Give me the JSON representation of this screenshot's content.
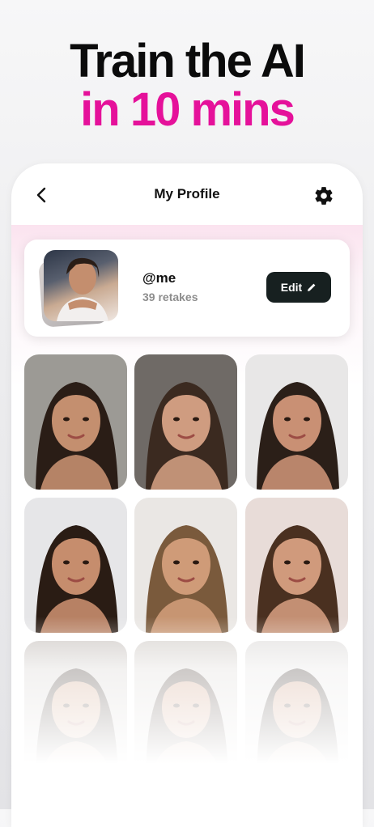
{
  "promo": {
    "line1": "Train the AI",
    "line2": "in 10 mins",
    "line2_color": "#e5119a"
  },
  "header": {
    "title": "My Profile",
    "back_icon": "chevron-left-icon",
    "settings_icon": "gear-icon"
  },
  "profile": {
    "handle": "@me",
    "retakes": "39 retakes",
    "edit_label": "Edit",
    "edit_icon": "pencil-icon",
    "button_color": "#172020"
  },
  "photos": [
    {
      "name": "photo-1",
      "bg": "#9c9a95",
      "skin": "#c48f6f",
      "hair": "#2a1d16"
    },
    {
      "name": "photo-2",
      "bg": "#6f6a66",
      "skin": "#cf9c80",
      "hair": "#3b2a20"
    },
    {
      "name": "photo-3",
      "bg": "#e8e7e7",
      "skin": "#c99074",
      "hair": "#2b1f18"
    },
    {
      "name": "photo-4",
      "bg": "#e6e6e8",
      "skin": "#c68d6d",
      "hair": "#2a1c14"
    },
    {
      "name": "photo-5",
      "bg": "#eae7e4",
      "skin": "#cf9b78",
      "hair": "#7a5a3c"
    },
    {
      "name": "photo-6",
      "bg": "#e8dcd8",
      "skin": "#d09a7c",
      "hair": "#4a3020"
    },
    {
      "name": "photo-7",
      "bg": "#cfcac7",
      "skin": "#c89474",
      "hair": "#2a1d16"
    },
    {
      "name": "photo-8",
      "bg": "#d8d4d0",
      "skin": "#c99172",
      "hair": "#3a2a22"
    },
    {
      "name": "photo-9",
      "bg": "#e3e1e0",
      "skin": "#c68e70",
      "hair": "#2b201a"
    }
  ]
}
